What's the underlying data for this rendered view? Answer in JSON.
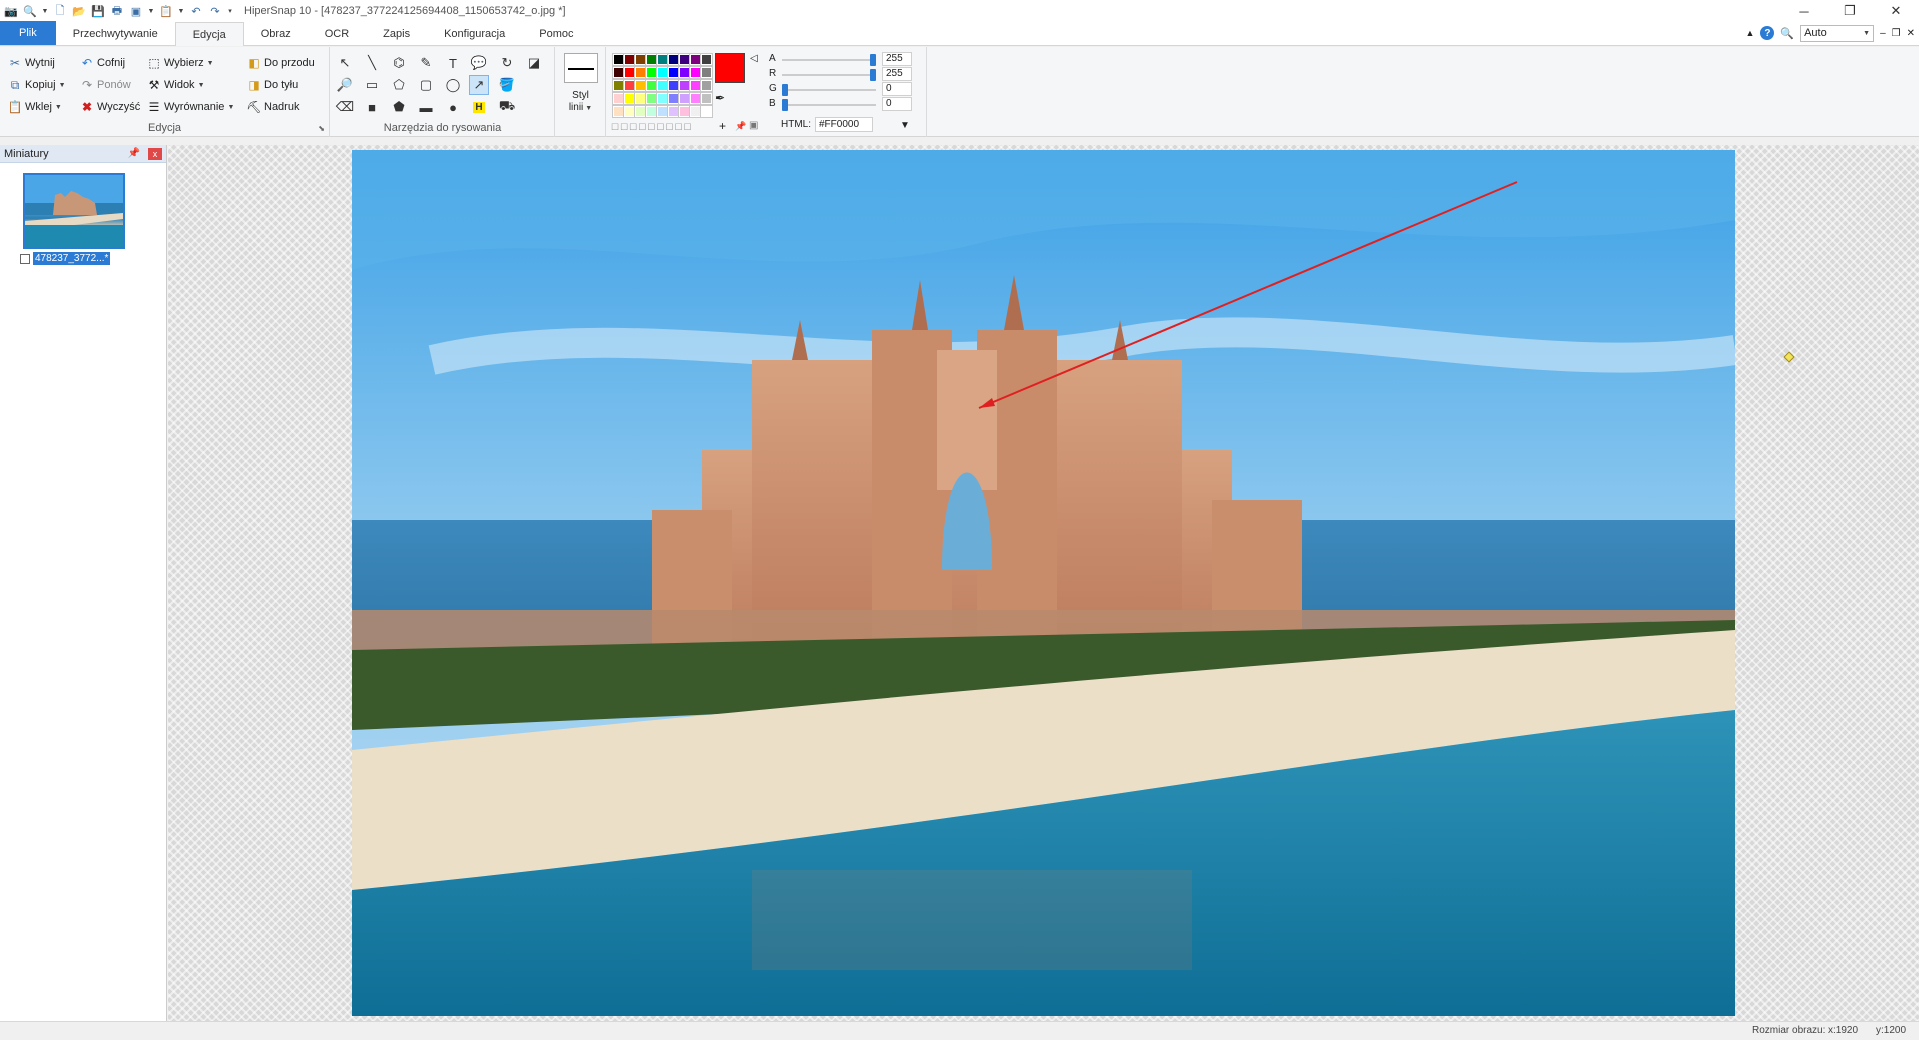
{
  "window": {
    "title": "HiperSnap 10 - [478237_377224125694408_1150653742_o.jpg *]",
    "zoom": "Auto"
  },
  "tabs": [
    "Plik",
    "Przechwytywanie",
    "Edycja",
    "Obraz",
    "OCR",
    "Zapis",
    "Konfiguracja",
    "Pomoc"
  ],
  "ribbon": {
    "edycja": {
      "label": "Edycja",
      "wytnij": "Wytnij",
      "kopiuj": "Kopiuj",
      "wklej": "Wklej",
      "cofnij": "Cofnij",
      "ponow": "Ponów",
      "wyczysc": "Wyczyść",
      "wybierz": "Wybierz",
      "widok": "Widok",
      "wyrownanie": "Wyrównanie",
      "do_przodu": "Do przodu",
      "do_tylu": "Do tyłu",
      "nadruk": "Nadruk"
    },
    "narzedzia": {
      "label": "Narzędzia do rysowania"
    },
    "styl": {
      "label1": "Styl",
      "label2": "linii"
    },
    "color": {
      "current": "#FF0000",
      "A": "255",
      "R": "255",
      "G": "0",
      "B": "0",
      "label_A": "A",
      "label_R": "R",
      "label_G": "G",
      "label_B": "B",
      "html_label": "HTML:",
      "html_value": "#FF0000",
      "slider_A": 1.0,
      "slider_R": 1.0,
      "slider_G": 0.0,
      "slider_B": 0.0,
      "palette": [
        "#000000",
        "#7f0000",
        "#7f3f00",
        "#007f00",
        "#007f7f",
        "#00007f",
        "#3f007f",
        "#7f007f",
        "#404040",
        "#3f0000",
        "#ff0000",
        "#ff7f00",
        "#00ff00",
        "#00ffff",
        "#0000ff",
        "#7f00ff",
        "#ff00ff",
        "#808080",
        "#7f7f00",
        "#ff3f3f",
        "#ffbf00",
        "#3fff3f",
        "#3fffff",
        "#3f3fff",
        "#bf3fff",
        "#ff3fff",
        "#a0a0a0",
        "#ffd0d0",
        "#ffff00",
        "#ffff7f",
        "#7fff7f",
        "#7fffff",
        "#7f7fff",
        "#d0a0ff",
        "#ff7fff",
        "#c0c0c0",
        "#ffe0c0",
        "#ffffc0",
        "#e0ffc0",
        "#c0ffe0",
        "#c0e0ff",
        "#e0c0ff",
        "#ffc0e0",
        "#f0f0f0",
        "#ffffff"
      ]
    }
  },
  "panel": {
    "title": "Miniatury",
    "thumb_name": "478237_3772...*"
  },
  "status": {
    "label": "Rozmiar obrazu:",
    "x": "x:1920",
    "y": "y:1200"
  }
}
